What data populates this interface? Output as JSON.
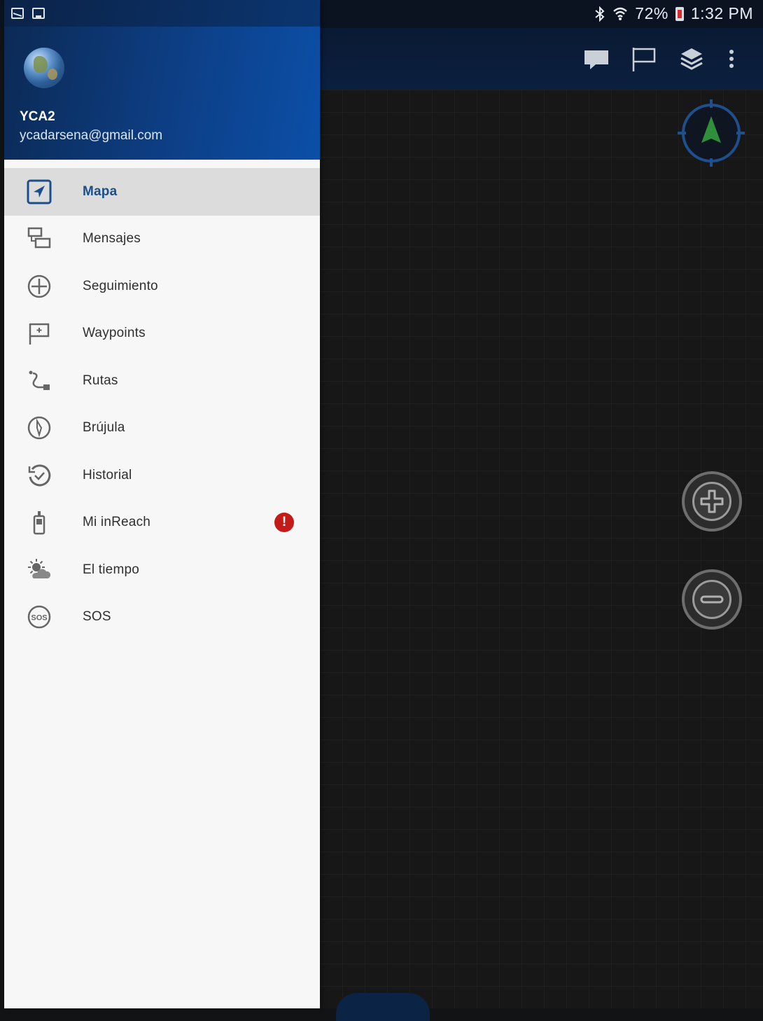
{
  "status_bar": {
    "battery_percent": "72%",
    "time": "1:32 PM",
    "icons": [
      "mail-icon",
      "image-icon",
      "bluetooth-icon",
      "wifi-icon",
      "battery-icon"
    ]
  },
  "toolbar": {
    "icons": [
      "chat-icon",
      "flag-icon",
      "layers-icon",
      "more-vert-icon"
    ]
  },
  "drawer": {
    "user": {
      "name": "YCA2",
      "email": "ycadarsena@gmail.com"
    },
    "items": [
      {
        "label": "Mapa",
        "icon": "navigation-arrow-icon",
        "active": true
      },
      {
        "label": "Mensajes",
        "icon": "messages-icon"
      },
      {
        "label": "Seguimiento",
        "icon": "tracking-crosshair-icon"
      },
      {
        "label": "Waypoints",
        "icon": "waypoint-flag-icon"
      },
      {
        "label": "Rutas",
        "icon": "route-icon"
      },
      {
        "label": "Brújula",
        "icon": "compass-icon"
      },
      {
        "label": "Historial",
        "icon": "history-clock-icon"
      },
      {
        "label": "Mi inReach",
        "icon": "inreach-device-icon",
        "badge": "!"
      },
      {
        "label": "El tiempo",
        "icon": "weather-icon"
      },
      {
        "label": "SOS",
        "icon": "sos-icon"
      }
    ]
  },
  "map": {
    "controls": [
      "compass-orientation",
      "zoom-in",
      "zoom-out"
    ]
  },
  "colors": {
    "accent": "#1b4f8a",
    "header_blue": "#0d3f86",
    "alert_red": "#c41a1a",
    "map_background": "#171717"
  }
}
